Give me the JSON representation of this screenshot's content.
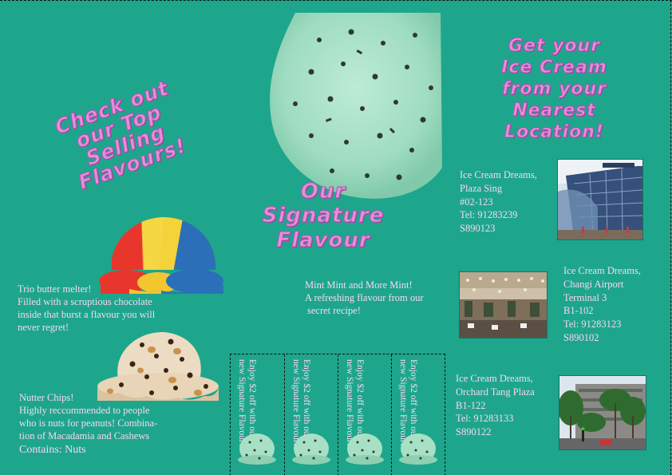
{
  "headings": {
    "top_selling": [
      "Check out",
      "our Top",
      "Selling",
      "Flavours!"
    ],
    "signature": [
      "Our",
      "Signature",
      "Flavour"
    ],
    "location": [
      "Get your",
      "Ice Cream",
      "from your",
      "Nearest",
      "Location!"
    ]
  },
  "flavours": {
    "trio": {
      "name": "Trio butter melter!",
      "description": [
        "Filled with a scruptious chocolate",
        "inside that burst a flavour you will",
        "never regret!"
      ]
    },
    "nutter": {
      "name": "Nutter Chips!",
      "description": [
        "Highly reccommended to people",
        "who is nuts for peanuts! Combina-",
        "tion of Macadamia and Cashews"
      ],
      "contains": "Contains: Nuts"
    },
    "mint": {
      "name": "Mint Mint and More Mint!",
      "description": [
        "A refreshing flavour from our",
        "secret recipe!"
      ]
    }
  },
  "coupon": {
    "text": "Enjoy $2 off with our new Signature Flavour!",
    "count": 4
  },
  "locations": [
    {
      "lines": [
        "Ice Cream Dreams,",
        "Plaza Sing",
        "#02-123",
        "Tel: 91283239",
        "S890123"
      ]
    },
    {
      "lines": [
        "Ice Cream Dreams,",
        "Changi Airport",
        "Terminal 3",
        "B1-102",
        "Tel: 91283123",
        "S890102"
      ]
    },
    {
      "lines": [
        "Ice Cream Dreams,",
        "Orchard Tang Plaza",
        "B1-122",
        "Tel: 91283133",
        "S890122"
      ]
    }
  ],
  "colors": {
    "background": "#1ea68c",
    "heading_pink": "#e48fd7",
    "text_pink": "#f6d8f2",
    "mint": "#a8e0c6"
  }
}
